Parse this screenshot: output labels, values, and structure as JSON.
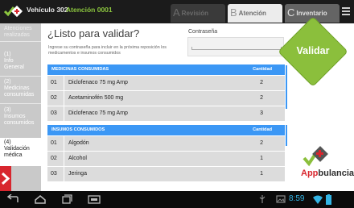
{
  "header": {
    "vehicle": "Vehículo 302",
    "attention": "Atención 0001",
    "tabs": [
      {
        "letter": "A",
        "label": "Revisión"
      },
      {
        "letter": "B",
        "label": "Atención"
      },
      {
        "letter": "C",
        "label": "Inventario"
      }
    ]
  },
  "sidebar": {
    "items": [
      {
        "lines": [
          "Atenciones",
          "realizadas"
        ]
      },
      {
        "lines": [
          "(1)",
          "Info",
          "General"
        ]
      },
      {
        "lines": [
          "(2)",
          "Medicinas",
          "consumidas"
        ]
      },
      {
        "lines": [
          "(3)",
          "Insumos",
          "consumidos"
        ]
      },
      {
        "lines": [
          "(4)",
          "Validación",
          "médica"
        ]
      }
    ]
  },
  "main": {
    "title": "¿Listo para validar?",
    "instruction": "Ingrese su contraseña para incluir en la próxima reposición los medicamentos e insumos consumidos",
    "password_label": "Contraseña",
    "validate_label": "Validar"
  },
  "medicines": {
    "header": "MEDICINAS CONSUMIDAS",
    "qty_header": "Cantidad",
    "rows": [
      {
        "n": "01",
        "desc": "Diclofenaco 75 mg Amp",
        "qty": "2"
      },
      {
        "n": "02",
        "desc": "Acetaminofén 500 mg",
        "qty": "2"
      },
      {
        "n": "03",
        "desc": "Diclofenaco 75 mg Amp",
        "qty": "3"
      }
    ]
  },
  "supplies": {
    "header": "INSUMOS CONSUMIDOS",
    "qty_header": "Cantidad",
    "rows": [
      {
        "n": "01",
        "desc": "Algodón",
        "qty": "2"
      },
      {
        "n": "02",
        "desc": "Alcohol",
        "qty": "1"
      },
      {
        "n": "03",
        "desc": "Jeringa",
        "qty": "1"
      }
    ]
  },
  "branding": {
    "app_name_a": "App",
    "app_name_b": "bulancia"
  },
  "system": {
    "time": "8:59"
  },
  "colors": {
    "accent_blue": "#3b97f5",
    "validate_green": "#8bbf3c",
    "brand_red": "#d8262e"
  }
}
